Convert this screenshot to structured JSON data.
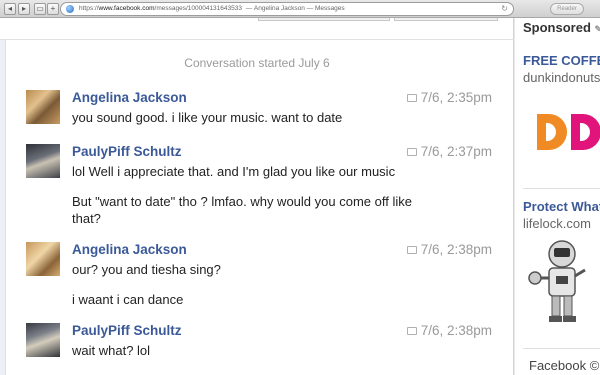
{
  "browser": {
    "url_scheme": "https",
    "url_host": "www.facebook.com",
    "url_path": "/messages/100004131643533",
    "page_title": "Angelina Jackson — Messages",
    "reader_label": "Reader"
  },
  "conversation": {
    "started_label": "Conversation started July 6",
    "messages": [
      {
        "sender": "Angelina Jackson",
        "time": "7/6, 2:35pm",
        "lines": [
          "you sound good. i like your music. want to date"
        ]
      },
      {
        "sender": "PaulyPiff Schultz",
        "time": "7/6, 2:37pm",
        "lines": [
          "lol Well i appreciate that. and I'm glad you like our music",
          "But \"want to date\" tho ? lmfao. why would you come off like",
          "that?"
        ]
      },
      {
        "sender": "Angelina Jackson",
        "time": "7/6, 2:38pm",
        "lines": [
          "our? you and tiesha sing?",
          "i waant i can dance"
        ]
      },
      {
        "sender": "PaulyPiff Schultz",
        "time": "7/6, 2:38pm",
        "lines": [
          "wait what? lol"
        ]
      }
    ]
  },
  "sidebar": {
    "sponsored_label": "Sponsored",
    "ads": [
      {
        "title": "FREE COFFEE",
        "domain": "dunkindonuts.com"
      },
      {
        "title": "Protect What",
        "domain": "lifelock.com"
      }
    ],
    "footer": "Facebook ©"
  },
  "colors": {
    "link_blue": "#3b5998",
    "dunkin_orange": "#f08a24",
    "dunkin_pink": "#e0147a"
  }
}
